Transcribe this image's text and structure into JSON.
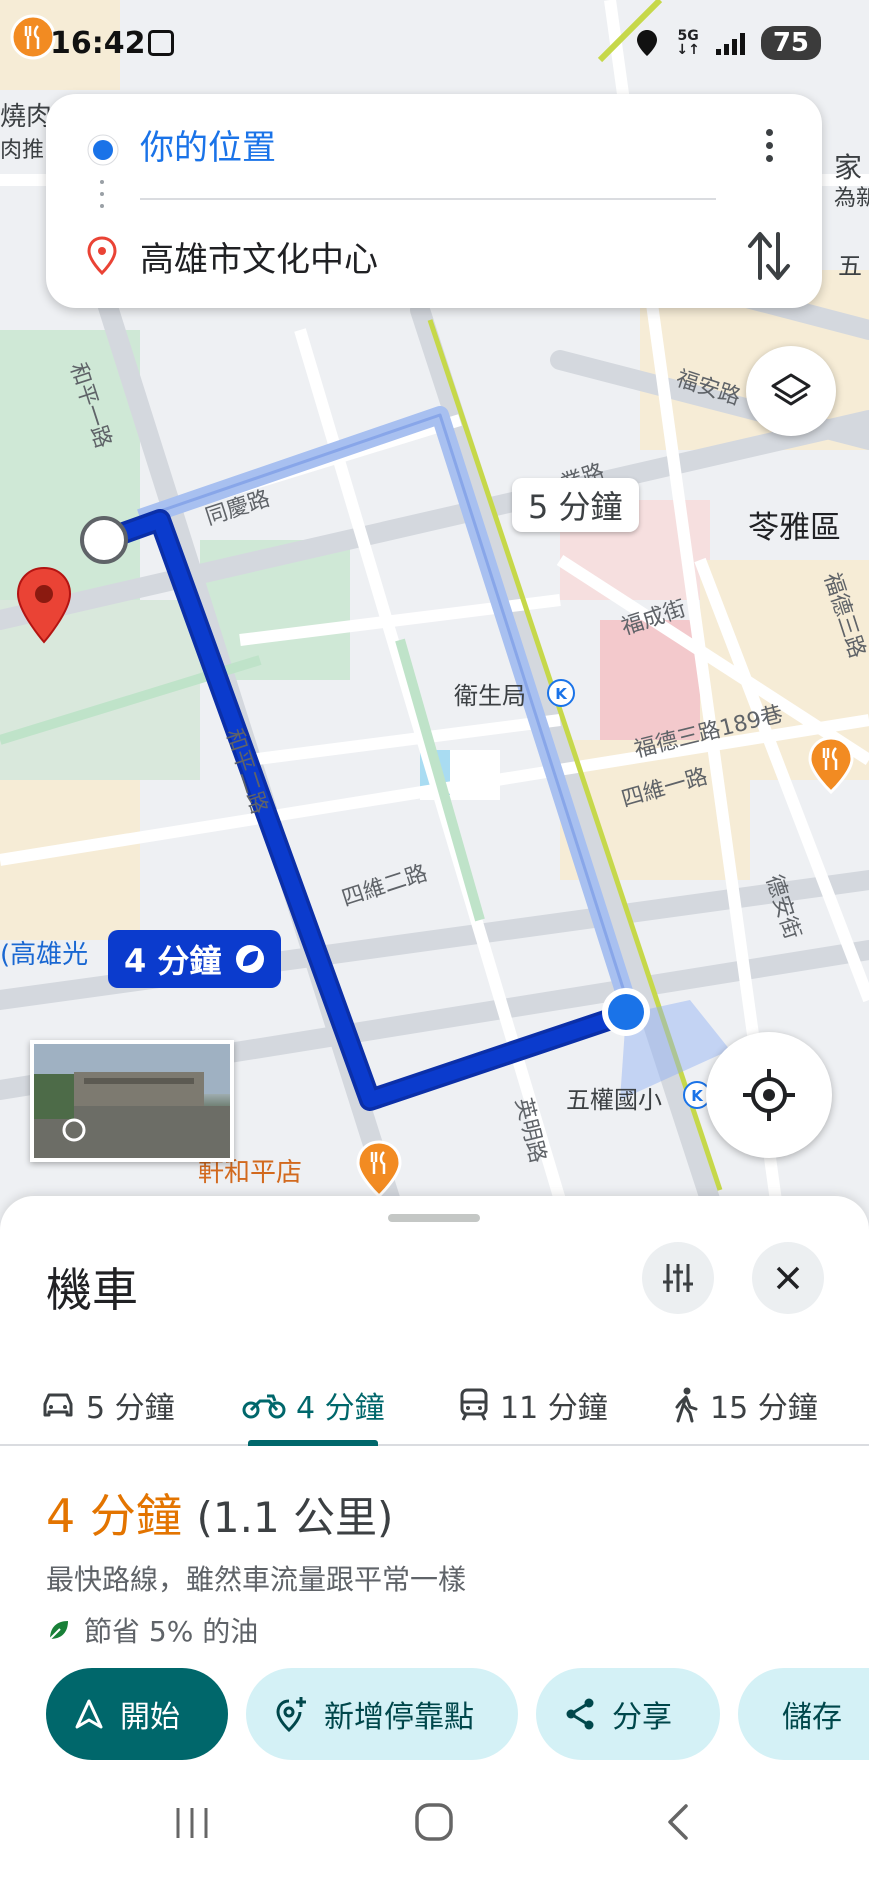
{
  "status_bar": {
    "time": "16:42",
    "network": "5G",
    "battery": "75"
  },
  "route_card": {
    "origin": "你的位置",
    "destination": "高雄市文化中心"
  },
  "map": {
    "route_time_alt": "5 分鐘",
    "route_time_selected": "4 分鐘",
    "district": "苓雅區",
    "streets": {
      "heping1": "和平一路",
      "tongqing": "同慶路",
      "fuan": "福安路",
      "heping2": "和平二路",
      "siwei2": "四維二路",
      "fucheng": "福成街",
      "fude3_189": "福德三路189巷",
      "siwei1": "四維一路",
      "dean": "德安街",
      "fude3": "福德三路",
      "yingming": "英明路",
      "ye": "業路"
    },
    "pois": {
      "health_bureau": "衛生局",
      "wuquan_school": "五權國小",
      "restaurant": "軒和平店",
      "gaoxiong_light": "(高雄光",
      "shaorou": "燒肉",
      "rou_tui": "肉推",
      "jia": "家",
      "wei_xin": "為新",
      "wu": "五"
    }
  },
  "sheet": {
    "mode_title": "機車",
    "tabs": [
      {
        "label": "5 分鐘",
        "icon": "car-icon"
      },
      {
        "label": "4 分鐘",
        "icon": "motorcycle-icon"
      },
      {
        "label": "11 分鐘",
        "icon": "transit-icon"
      },
      {
        "label": "15 分鐘",
        "icon": "walk-icon"
      }
    ],
    "summary_time": "4 分鐘",
    "summary_distance": "(1.1 公里)",
    "description": "最快路線，雖然車流量跟平常一樣",
    "eco_text": "節省 5% 的油",
    "buttons": {
      "start": "開始",
      "add_stop": "新增停靠點",
      "share": "分享",
      "save": "儲存"
    }
  },
  "colors": {
    "route_blue": "#0b3bcd",
    "route_alt": "#a8c0f0",
    "accent_teal": "#00676b",
    "time_orange": "#e37400",
    "pill_light": "#d4f1f6"
  }
}
